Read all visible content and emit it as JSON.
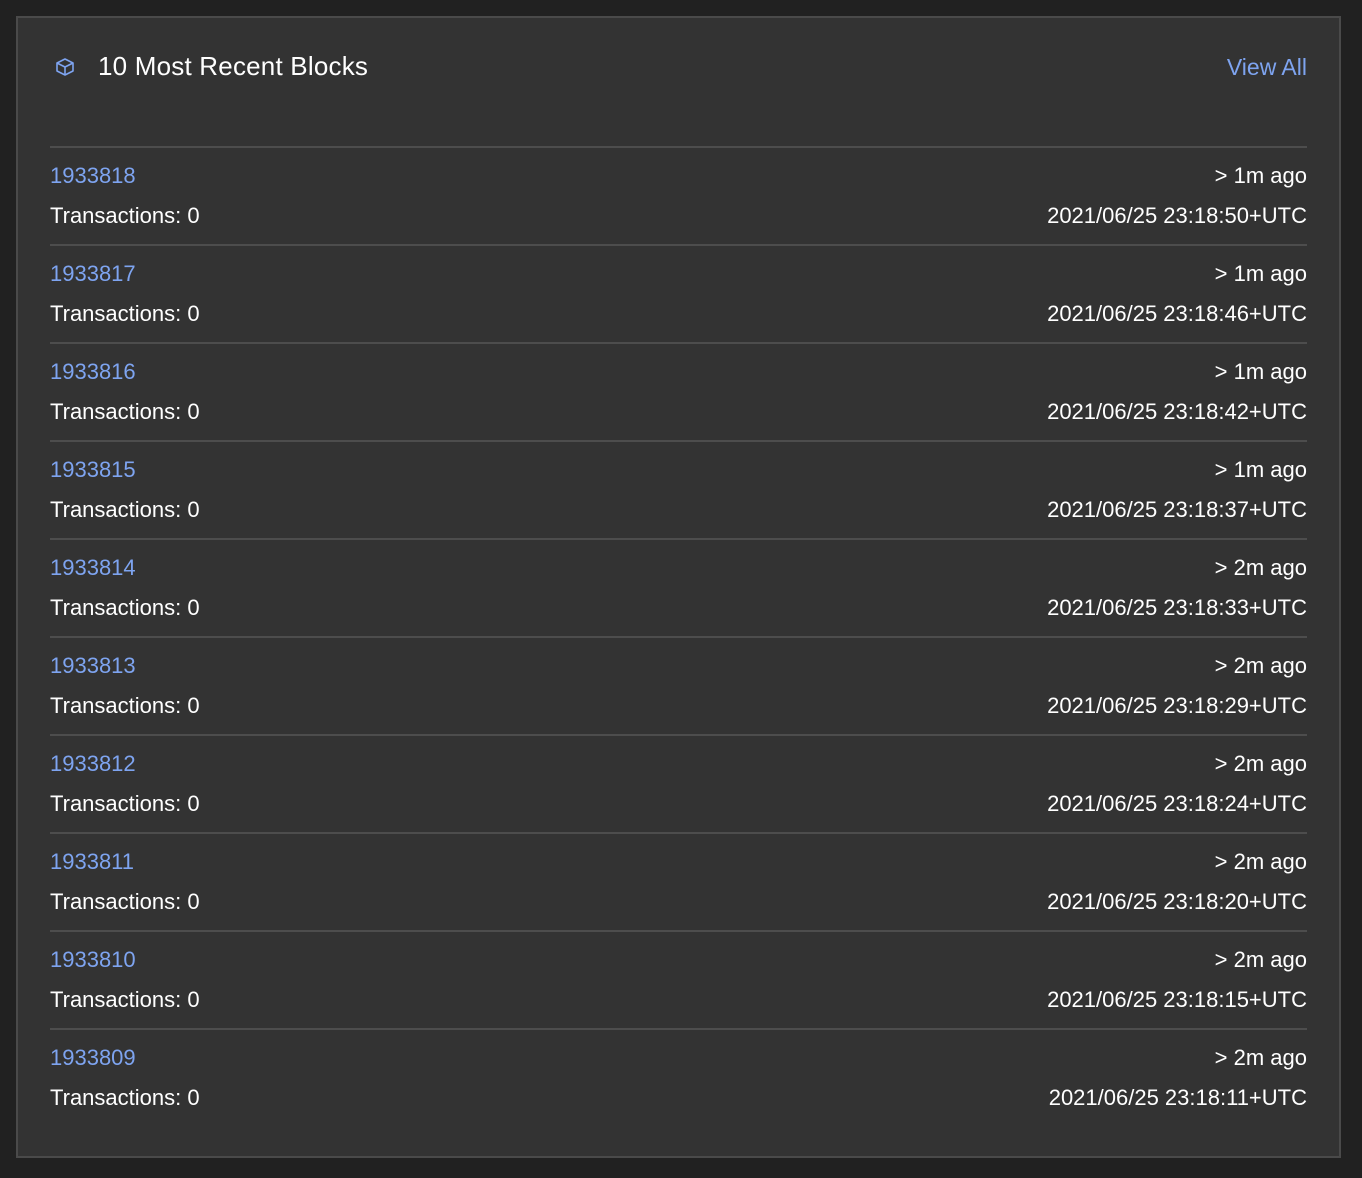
{
  "header": {
    "title": "10 Most Recent Blocks",
    "icon": "cube-icon",
    "view_all_label": "View All"
  },
  "colors": {
    "background": "#212121",
    "panel": "#333333",
    "link": "#7ea4f0",
    "divider": "#4d4d4d",
    "text": "#ffffff"
  },
  "blocks": [
    {
      "height": "1933818",
      "transactions": "Transactions: 0",
      "ago": "> 1m ago",
      "time": "2021/06/25 23:18:50+UTC"
    },
    {
      "height": "1933817",
      "transactions": "Transactions: 0",
      "ago": "> 1m ago",
      "time": "2021/06/25 23:18:46+UTC"
    },
    {
      "height": "1933816",
      "transactions": "Transactions: 0",
      "ago": "> 1m ago",
      "time": "2021/06/25 23:18:42+UTC"
    },
    {
      "height": "1933815",
      "transactions": "Transactions: 0",
      "ago": "> 1m ago",
      "time": "2021/06/25 23:18:37+UTC"
    },
    {
      "height": "1933814",
      "transactions": "Transactions: 0",
      "ago": "> 2m ago",
      "time": "2021/06/25 23:18:33+UTC"
    },
    {
      "height": "1933813",
      "transactions": "Transactions: 0",
      "ago": "> 2m ago",
      "time": "2021/06/25 23:18:29+UTC"
    },
    {
      "height": "1933812",
      "transactions": "Transactions: 0",
      "ago": "> 2m ago",
      "time": "2021/06/25 23:18:24+UTC"
    },
    {
      "height": "1933811",
      "transactions": "Transactions: 0",
      "ago": "> 2m ago",
      "time": "2021/06/25 23:18:20+UTC"
    },
    {
      "height": "1933810",
      "transactions": "Transactions: 0",
      "ago": "> 2m ago",
      "time": "2021/06/25 23:18:15+UTC"
    },
    {
      "height": "1933809",
      "transactions": "Transactions: 0",
      "ago": "> 2m ago",
      "time": "2021/06/25 23:18:11+UTC"
    }
  ]
}
